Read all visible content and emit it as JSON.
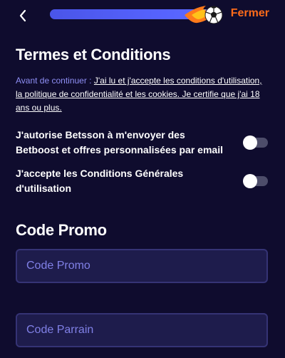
{
  "header": {
    "back_icon": "chevron-left-icon",
    "progress_fraction": 0.97,
    "progress_icon": "flaming-soccer-ball-icon",
    "close_label": "Fermer"
  },
  "terms": {
    "title": "Termes et Conditions",
    "intro_lead": "Avant de continuer :",
    "intro_link": "J'ai lu et j'accepte les conditions d'utilisation, la politique de confidentialité et les cookies. Je certifie que j'ai 18 ans ou plus.",
    "options": [
      {
        "label": "J'autorise Betsson à m'envoyer des Betboost et offres personnalisées par email",
        "enabled": false
      },
      {
        "label": "J'accepte les Conditions Générales d'utilisation",
        "enabled": false
      }
    ]
  },
  "promo": {
    "title": "Code Promo",
    "promo_placeholder": "Code Promo",
    "sponsor_placeholder": "Code Parrain"
  },
  "colors": {
    "background": "#0f0c2e",
    "accent_orange": "#ff6b1a",
    "progress_blue": "#5663ff",
    "input_bg": "#1e1c4c",
    "input_border": "#353375",
    "placeholder": "#8080e6"
  }
}
